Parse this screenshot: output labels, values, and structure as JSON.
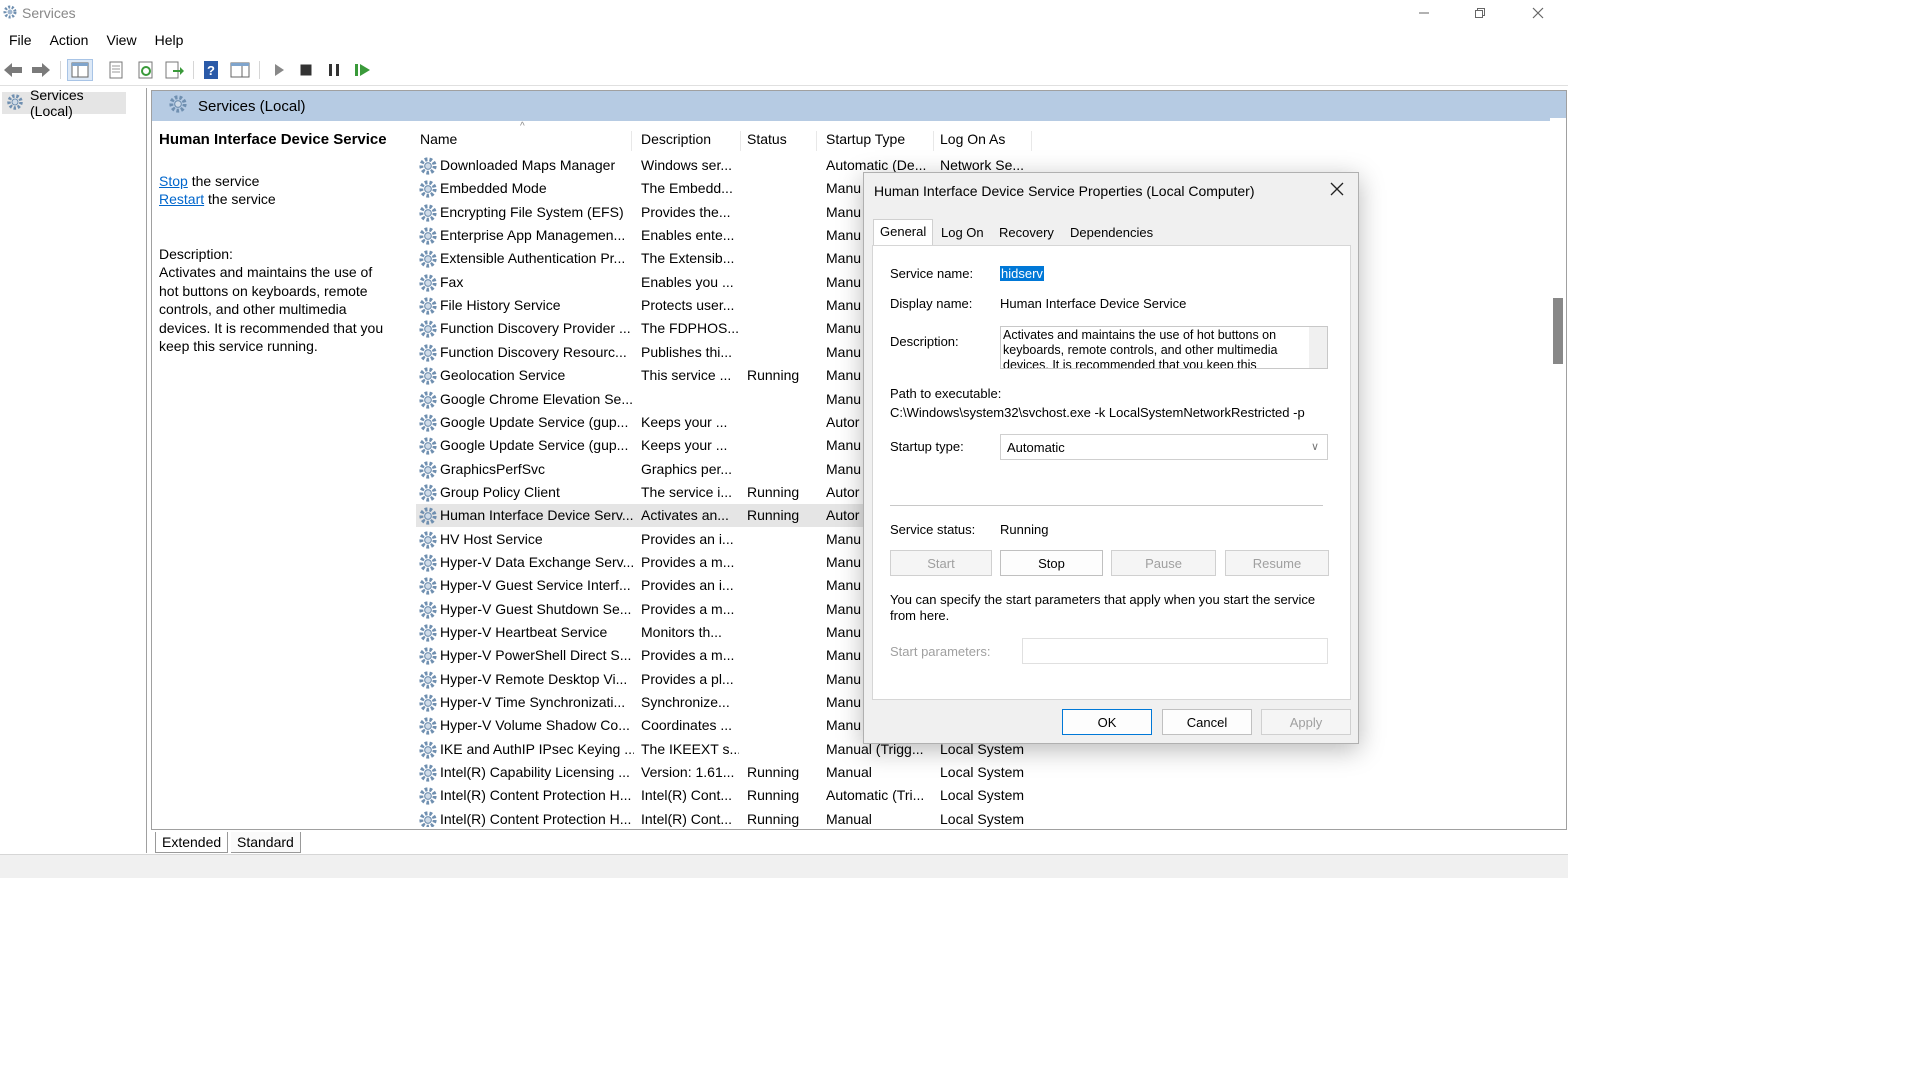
{
  "window": {
    "title": "Services"
  },
  "menu": [
    "File",
    "Action",
    "View",
    "Help"
  ],
  "tree": {
    "root_label": "Services (Local)"
  },
  "main": {
    "header": "Services (Local)",
    "extended": {
      "service_title": "Human Interface Device Service",
      "stop_link": "Stop",
      "stop_suffix": " the service",
      "restart_link": "Restart",
      "restart_suffix": " the service",
      "desc_label": "Description:",
      "desc_text": "Activates and maintains the use of hot buttons on keyboards, remote controls, and other multimedia devices. It is recommended that you keep this service running."
    },
    "columns": [
      "Name",
      "Description",
      "Status",
      "Startup Type",
      "Log On As"
    ],
    "rows": [
      {
        "name": "Downloaded Maps Manager",
        "description": "Windows ser...",
        "status": "",
        "startup": "Automatic (De...",
        "logon": "Network Se..."
      },
      {
        "name": "Embedded Mode",
        "description": "The Embedd...",
        "status": "",
        "startup": "Manu",
        "logon": ""
      },
      {
        "name": "Encrypting File System (EFS)",
        "description": "Provides the...",
        "status": "",
        "startup": "Manu",
        "logon": ""
      },
      {
        "name": "Enterprise App Managemen...",
        "description": "Enables ente...",
        "status": "",
        "startup": "Manu",
        "logon": ""
      },
      {
        "name": "Extensible Authentication Pr...",
        "description": "The Extensib...",
        "status": "",
        "startup": "Manu",
        "logon": ""
      },
      {
        "name": "Fax",
        "description": "Enables you ...",
        "status": "",
        "startup": "Manu",
        "logon": ""
      },
      {
        "name": "File History Service",
        "description": "Protects user...",
        "status": "",
        "startup": "Manu",
        "logon": ""
      },
      {
        "name": "Function Discovery Provider ...",
        "description": "The FDPHOS...",
        "status": "",
        "startup": "Manu",
        "logon": ""
      },
      {
        "name": "Function Discovery Resourc...",
        "description": "Publishes thi...",
        "status": "",
        "startup": "Manu",
        "logon": ""
      },
      {
        "name": "Geolocation Service",
        "description": "This service ...",
        "status": "Running",
        "startup": "Manu",
        "logon": ""
      },
      {
        "name": "Google Chrome Elevation Se...",
        "description": "",
        "status": "",
        "startup": "Manu",
        "logon": ""
      },
      {
        "name": "Google Update Service (gup...",
        "description": "Keeps your ...",
        "status": "",
        "startup": "Autor",
        "logon": ""
      },
      {
        "name": "Google Update Service (gup...",
        "description": "Keeps your ...",
        "status": "",
        "startup": "Manu",
        "logon": ""
      },
      {
        "name": "GraphicsPerfSvc",
        "description": "Graphics per...",
        "status": "",
        "startup": "Manu",
        "logon": ""
      },
      {
        "name": "Group Policy Client",
        "description": "The service i...",
        "status": "Running",
        "startup": "Autor",
        "logon": ""
      },
      {
        "name": "Human Interface Device Serv...",
        "description": "Activates an...",
        "status": "Running",
        "startup": "Autor",
        "logon": "",
        "selected": true
      },
      {
        "name": "HV Host Service",
        "description": "Provides an i...",
        "status": "",
        "startup": "Manu",
        "logon": ""
      },
      {
        "name": "Hyper-V Data Exchange Serv...",
        "description": "Provides a m...",
        "status": "",
        "startup": "Manu",
        "logon": ""
      },
      {
        "name": "Hyper-V Guest Service Interf...",
        "description": "Provides an i...",
        "status": "",
        "startup": "Manu",
        "logon": ""
      },
      {
        "name": "Hyper-V Guest Shutdown Se...",
        "description": "Provides a m...",
        "status": "",
        "startup": "Manu",
        "logon": ""
      },
      {
        "name": "Hyper-V Heartbeat Service",
        "description": "Monitors th...",
        "status": "",
        "startup": "Manu",
        "logon": ""
      },
      {
        "name": "Hyper-V PowerShell Direct S...",
        "description": "Provides a m...",
        "status": "",
        "startup": "Manu",
        "logon": ""
      },
      {
        "name": "Hyper-V Remote Desktop Vi...",
        "description": "Provides a pl...",
        "status": "",
        "startup": "Manu",
        "logon": ""
      },
      {
        "name": "Hyper-V Time Synchronizati...",
        "description": "Synchronize...",
        "status": "",
        "startup": "Manu",
        "logon": ""
      },
      {
        "name": "Hyper-V Volume Shadow Co...",
        "description": "Coordinates ...",
        "status": "",
        "startup": "Manu",
        "logon": ""
      },
      {
        "name": "IKE and AuthIP IPsec Keying ...",
        "description": "The IKEEXT s...",
        "status": "",
        "startup": "Manual (Trigg...",
        "logon": "Local System"
      },
      {
        "name": "Intel(R) Capability Licensing ...",
        "description": "Version: 1.61...",
        "status": "Running",
        "startup": "Manual",
        "logon": "Local System"
      },
      {
        "name": "Intel(R) Content Protection H...",
        "description": "Intel(R) Cont...",
        "status": "Running",
        "startup": "Automatic (Tri...",
        "logon": "Local System"
      },
      {
        "name": "Intel(R) Content Protection H...",
        "description": "Intel(R) Cont...",
        "status": "Running",
        "startup": "Manual",
        "logon": "Local System"
      }
    ],
    "view_tabs": [
      "Extended",
      "Standard"
    ]
  },
  "dialog": {
    "title": "Human Interface Device Service Properties (Local Computer)",
    "tabs": [
      "General",
      "Log On",
      "Recovery",
      "Dependencies"
    ],
    "service_name_label": "Service name:",
    "service_name": "hidserv",
    "display_name_label": "Display name:",
    "display_name": "Human Interface Device Service",
    "description_label": "Description:",
    "description": "Activates and maintains the use of hot buttons on keyboards, remote controls, and other multimedia devices. It is recommended that you keep this",
    "path_label": "Path to executable:",
    "path": "C:\\Windows\\system32\\svchost.exe -k LocalSystemNetworkRestricted -p",
    "startup_type_label": "Startup type:",
    "startup_type": "Automatic",
    "status_label": "Service status:",
    "status": "Running",
    "buttons": {
      "start": "Start",
      "stop": "Stop",
      "pause": "Pause",
      "resume": "Resume"
    },
    "hint": "You can specify the start parameters that apply when you start the service from here.",
    "params_label": "Start parameters:",
    "ok": "OK",
    "cancel": "Cancel",
    "apply": "Apply"
  }
}
